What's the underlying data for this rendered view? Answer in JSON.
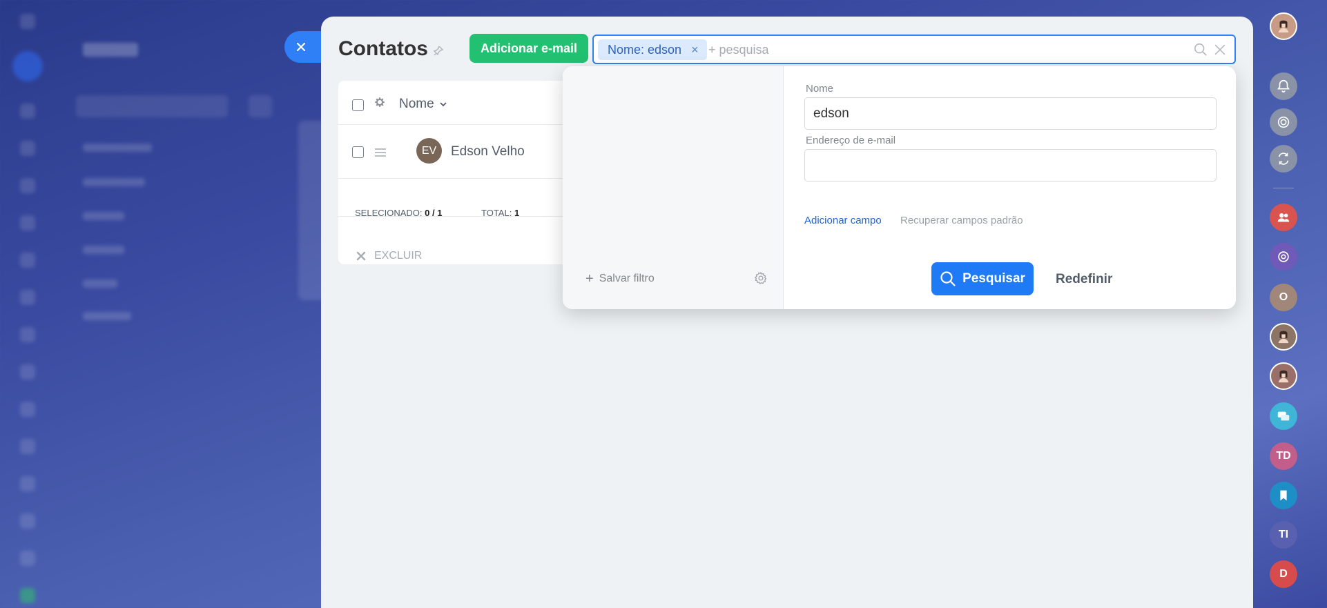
{
  "slider": {
    "close_label": "×"
  },
  "page": {
    "title": "Contatos",
    "add_email_label": "Adicionar e-mail"
  },
  "search": {
    "chip_label": "Nome: edson",
    "chip_remove": "×",
    "placeholder": "+ pesquisa"
  },
  "list": {
    "column_header": "Nome",
    "rows": [
      {
        "initials": "EV",
        "name": "Edson Velho"
      }
    ],
    "selected_label": "SELECIONADO:",
    "selected_value": "0 / 1",
    "total_label": "TOTAL:",
    "total_value": "1",
    "delete_label": "EXCLUIR"
  },
  "filter": {
    "save_filter_label": "Salvar filtro",
    "fields": [
      {
        "label": "Nome",
        "value": "edson"
      },
      {
        "label": "Endereço de e-mail",
        "value": ""
      }
    ],
    "add_field_label": "Adicionar campo",
    "restore_fields_label": "Recuperar campos padrão",
    "search_button_label": "Pesquisar",
    "reset_button_label": "Redefinir"
  },
  "right_bar": {
    "items": [
      {
        "kind": "avatar-photo",
        "color": "#c79b86"
      },
      {
        "kind": "bell-icon",
        "color": "#8a92a8"
      },
      {
        "kind": "target-icon",
        "color": "#8a92a8"
      },
      {
        "kind": "sync-icon",
        "color": "#8a92a8"
      },
      {
        "kind": "group-icon",
        "color": "#d9534f"
      },
      {
        "kind": "chat-circle-icon",
        "color": "#6f5ab8"
      },
      {
        "kind": "initial",
        "text": "O",
        "color": "#a0877a"
      },
      {
        "kind": "avatar-photo",
        "color": "#8c7466"
      },
      {
        "kind": "avatar-photo",
        "color": "#9a6f6a"
      },
      {
        "kind": "chat-bubbles-icon",
        "color": "#3fb5d8"
      },
      {
        "kind": "initial",
        "text": "TD",
        "color": "#c25e8a"
      },
      {
        "kind": "bookmark-icon",
        "color": "#1e8fc6"
      },
      {
        "kind": "initial",
        "text": "TI",
        "color": "#5a60b0"
      },
      {
        "kind": "initial",
        "text": "D",
        "color": "#d64c4c"
      }
    ]
  },
  "colors": {
    "accent": "#2f80f6",
    "success": "#22c172",
    "panel_bg": "#eef2f4"
  }
}
